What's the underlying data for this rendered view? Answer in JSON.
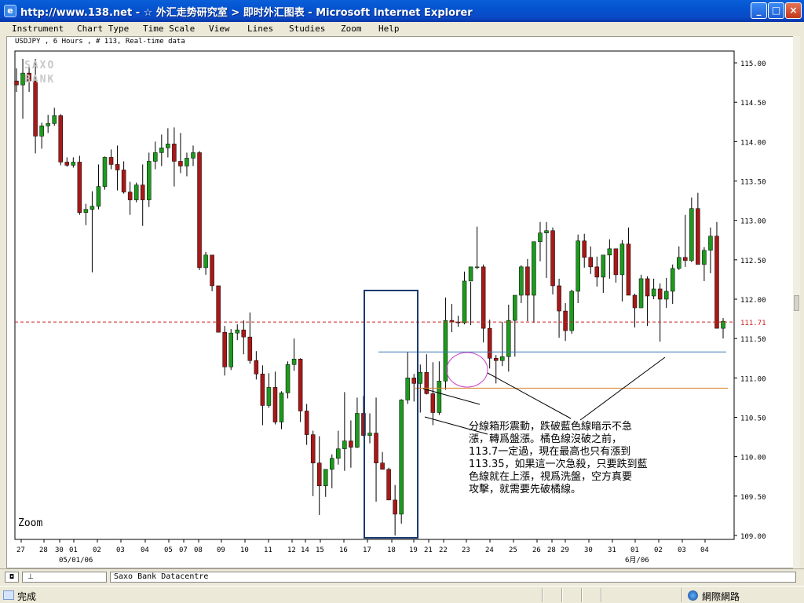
{
  "window": {
    "title": "http://www.138.net - ☆ 外汇走势研究室 > 即时外汇图表 - Microsoft Internet Explorer",
    "icon": "ie-icon",
    "buttons": {
      "minimize": "_",
      "maximize": "□",
      "close": "×"
    }
  },
  "menu": [
    "Instrument",
    "Chart Type",
    "Time Scale",
    "View",
    "Lines",
    "Studies",
    "Zoom",
    "Help"
  ],
  "chart_info": "USDJPY , 6 Hours , # 113, Real-time data",
  "watermark": [
    "SAXO",
    "BANK"
  ],
  "zoom_label": "Zoom",
  "current_price_label": "111.71",
  "annotation": [
    "分線箱形震動，跌破藍色線暗示不急",
    "漲，轉爲盤漲。橘色線沒破之前，",
    "113.7一定過，現在最高也只有漲到",
    "113.35，如果這一次急殺，只要跌到藍",
    "色線就在上漲，視爲洗盤，空方真要",
    "攻擊，就需要先破橘線。"
  ],
  "bottom_bar": {
    "button1": "◘",
    "button2": "⊥",
    "source": "Saxo Bank Datacentre"
  },
  "status": {
    "text": "完成",
    "zone": "網際網路"
  },
  "colors": {
    "up": "#1d9a1d",
    "down": "#a81818",
    "wick": "#000000",
    "current_price_line": "#cc2222",
    "blue_line": "#3a7ab8",
    "orange_line": "#d9822b",
    "box": "#1a3a6e",
    "circle": "#cc44cc"
  },
  "chart_data": {
    "type": "candlestick",
    "title": "USDJPY , 6 Hours , # 113, Real-time data",
    "ylim": [
      108.95,
      115.15
    ],
    "y_ticks": [
      "115.00",
      "114.50",
      "114.00",
      "113.50",
      "113.00",
      "112.50",
      "112.00",
      "111.50",
      "111.00",
      "110.50",
      "110.00",
      "109.50",
      "109.00"
    ],
    "x_ticks": [
      "27",
      "28",
      "30",
      "01",
      "02",
      "03",
      "04",
      "05",
      "07",
      "08",
      "09",
      "10",
      "11",
      "12",
      "14",
      "15",
      "16",
      "17",
      "18",
      "19",
      "21",
      "22",
      "23",
      "24",
      "25",
      "26",
      "28",
      "29",
      "30",
      "31",
      "01",
      "02",
      "03",
      "04"
    ],
    "x_sublabels": [
      "05/01/06",
      "6月/06"
    ],
    "reference_lines": {
      "current": 111.71,
      "blue": 111.33,
      "orange": 110.87
    },
    "ohlc": [
      [
        114.77,
        114.93,
        114.63,
        114.72
      ],
      [
        114.72,
        115.05,
        114.29,
        114.87
      ],
      [
        114.87,
        114.95,
        114.63,
        114.77
      ],
      [
        114.77,
        115.05,
        113.85,
        114.07
      ],
      [
        114.07,
        114.24,
        113.91,
        114.2
      ],
      [
        114.2,
        114.34,
        114.11,
        114.23
      ],
      [
        114.23,
        114.43,
        114.2,
        114.33
      ],
      [
        114.33,
        114.35,
        113.7,
        113.74
      ],
      [
        113.74,
        113.8,
        113.68,
        113.7
      ],
      [
        113.7,
        113.8,
        113.67,
        113.74
      ],
      [
        113.74,
        113.82,
        113.07,
        113.1
      ],
      [
        113.1,
        113.21,
        112.94,
        113.14
      ],
      [
        113.14,
        113.37,
        112.34,
        113.18
      ],
      [
        113.18,
        113.71,
        113.14,
        113.43
      ],
      [
        113.43,
        113.81,
        113.39,
        113.8
      ],
      [
        113.8,
        113.9,
        113.65,
        113.71
      ],
      [
        113.71,
        113.95,
        113.38,
        113.64
      ],
      [
        113.64,
        113.75,
        113.34,
        113.36
      ],
      [
        113.36,
        113.49,
        113.07,
        113.26
      ],
      [
        113.26,
        113.48,
        113.23,
        113.45
      ],
      [
        113.45,
        113.71,
        112.93,
        113.26
      ],
      [
        113.26,
        113.86,
        113.17,
        113.75
      ],
      [
        113.75,
        114.0,
        113.65,
        113.86
      ],
      [
        113.86,
        114.09,
        113.69,
        113.92
      ],
      [
        113.92,
        114.17,
        113.8,
        113.97
      ],
      [
        113.97,
        114.18,
        113.43,
        113.75
      ],
      [
        113.75,
        114.11,
        113.6,
        113.69
      ],
      [
        113.69,
        113.86,
        113.56,
        113.79
      ],
      [
        113.79,
        113.95,
        113.69,
        113.86
      ],
      [
        113.86,
        113.88,
        112.37,
        112.4
      ],
      [
        112.4,
        112.6,
        112.31,
        112.56
      ],
      [
        112.56,
        112.3,
        112.1,
        112.17
      ],
      [
        112.17,
        112.08,
        111.65,
        111.58
      ],
      [
        111.58,
        111.66,
        111.03,
        111.14
      ],
      [
        111.14,
        111.62,
        111.1,
        111.57
      ],
      [
        111.57,
        111.68,
        111.48,
        111.61
      ],
      [
        111.61,
        111.73,
        111.3,
        111.52
      ],
      [
        111.52,
        111.83,
        111.18,
        111.22
      ],
      [
        111.22,
        111.34,
        110.98,
        111.05
      ],
      [
        111.05,
        111.16,
        110.4,
        110.65
      ],
      [
        110.65,
        111.06,
        110.62,
        110.88
      ],
      [
        110.88,
        111.08,
        110.41,
        110.44
      ],
      [
        110.44,
        110.83,
        110.35,
        110.81
      ],
      [
        110.81,
        111.21,
        110.74,
        111.17
      ],
      [
        111.17,
        111.5,
        111.09,
        111.24
      ],
      [
        111.24,
        111.25,
        110.44,
        110.58
      ],
      [
        110.58,
        110.67,
        110.15,
        110.28
      ],
      [
        110.28,
        110.33,
        109.5,
        109.92
      ],
      [
        109.92,
        110.26,
        109.26,
        109.63
      ],
      [
        109.63,
        109.67,
        109.49,
        109.84
      ],
      [
        109.84,
        110.03,
        109.6,
        109.98
      ],
      [
        109.98,
        110.33,
        109.9,
        110.1
      ],
      [
        110.1,
        110.82,
        109.82,
        110.2
      ],
      [
        110.2,
        110.46,
        109.86,
        110.12
      ],
      [
        110.12,
        110.75,
        110.11,
        110.55
      ],
      [
        110.55,
        110.77,
        110.26,
        110.27
      ],
      [
        110.27,
        110.55,
        110.17,
        110.3
      ],
      [
        110.3,
        110.75,
        109.43,
        109.92
      ],
      [
        109.92,
        110.06,
        109.86,
        109.84
      ],
      [
        109.84,
        109.86,
        109.48,
        109.45
      ],
      [
        109.45,
        109.64,
        109.0,
        109.27
      ],
      [
        109.27,
        110.73,
        109.15,
        110.72
      ],
      [
        110.72,
        111.33,
        110.67,
        111.0
      ],
      [
        111.0,
        111.05,
        110.7,
        110.93
      ],
      [
        110.93,
        111.17,
        110.56,
        111.07
      ],
      [
        111.07,
        111.3,
        110.79,
        110.8
      ],
      [
        110.8,
        111.2,
        110.4,
        110.56
      ],
      [
        110.56,
        111.21,
        110.53,
        110.96
      ],
      [
        110.96,
        112.02,
        110.85,
        111.73
      ],
      [
        111.73,
        111.94,
        111.58,
        111.71
      ],
      [
        111.71,
        111.79,
        111.65,
        111.7
      ],
      [
        111.7,
        112.35,
        111.68,
        112.23
      ],
      [
        112.23,
        112.22,
        111.67,
        112.41
      ],
      [
        112.41,
        112.92,
        112.38,
        112.41
      ],
      [
        112.41,
        112.44,
        111.45,
        111.63
      ],
      [
        111.63,
        111.74,
        111.12,
        111.25
      ],
      [
        111.25,
        111.29,
        110.93,
        111.22
      ],
      [
        111.22,
        111.71,
        111.15,
        111.27
      ],
      [
        111.27,
        111.93,
        111.08,
        111.73
      ],
      [
        111.73,
        111.88,
        111.27,
        112.05
      ],
      [
        112.05,
        112.43,
        111.95,
        112.41
      ],
      [
        112.41,
        112.51,
        111.72,
        112.05
      ],
      [
        112.05,
        112.47,
        111.7,
        112.73
      ],
      [
        112.73,
        112.98,
        112.48,
        112.84
      ],
      [
        112.84,
        112.98,
        112.27,
        112.87
      ],
      [
        112.87,
        112.91,
        112.06,
        112.17
      ],
      [
        112.17,
        112.26,
        111.51,
        111.85
      ],
      [
        111.85,
        111.95,
        111.47,
        111.6
      ],
      [
        111.6,
        112.12,
        111.56,
        112.1
      ],
      [
        112.1,
        112.82,
        111.95,
        112.74
      ],
      [
        112.74,
        112.83,
        112.4,
        112.53
      ],
      [
        112.53,
        112.67,
        112.32,
        112.41
      ],
      [
        112.41,
        112.54,
        112.16,
        112.28
      ],
      [
        112.28,
        112.42,
        112.08,
        112.56
      ],
      [
        112.56,
        112.76,
        112.26,
        112.64
      ],
      [
        112.64,
        112.64,
        112.21,
        112.31
      ],
      [
        112.31,
        112.75,
        111.97,
        112.7
      ],
      [
        112.7,
        112.91,
        112.14,
        112.05
      ],
      [
        112.05,
        112.07,
        111.64,
        111.89
      ],
      [
        111.89,
        112.31,
        111.89,
        112.26
      ],
      [
        112.26,
        112.29,
        111.66,
        112.04
      ],
      [
        112.04,
        112.26,
        112.0,
        112.13
      ],
      [
        112.13,
        112.2,
        111.46,
        112.0
      ],
      [
        112.0,
        112.27,
        111.89,
        112.1
      ],
      [
        112.1,
        112.44,
        111.94,
        112.39
      ],
      [
        112.39,
        112.67,
        112.37,
        112.53
      ],
      [
        112.53,
        113.07,
        112.41,
        112.49
      ],
      [
        112.49,
        113.29,
        112.47,
        113.15
      ],
      [
        113.15,
        113.35,
        112.57,
        112.44
      ],
      [
        112.44,
        112.66,
        112.23,
        112.62
      ],
      [
        112.62,
        112.91,
        112.33,
        112.8
      ],
      [
        112.8,
        112.98,
        112.4,
        111.63
      ],
      [
        111.63,
        111.76,
        111.5,
        111.72
      ]
    ]
  }
}
